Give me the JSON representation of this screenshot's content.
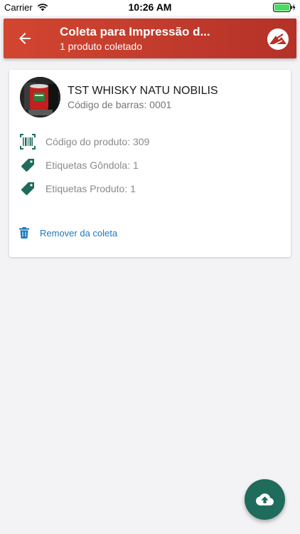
{
  "status_bar": {
    "carrier": "Carrier",
    "time": "10:26 AM"
  },
  "header": {
    "title": "Coleta para Impressão d...",
    "subtitle": "1 produto coletado"
  },
  "product": {
    "name": "TST WHISKY NATU NOBILIS",
    "barcode": "Código de barras: 0001",
    "details": [
      {
        "icon": "barcode-icon",
        "text": "Código do produto: 309"
      },
      {
        "icon": "tag-icon",
        "text": "Etiquetas Gôndola: 1"
      },
      {
        "icon": "tag-icon",
        "text": "Etiquetas Produto: 1"
      }
    ],
    "remove_label": "Remover da coleta"
  },
  "colors": {
    "header": "#c03a2c",
    "accent_green": "#1f6b5c",
    "link_blue": "#1a78c2"
  },
  "fab": {
    "icon": "cloud-upload-icon"
  }
}
